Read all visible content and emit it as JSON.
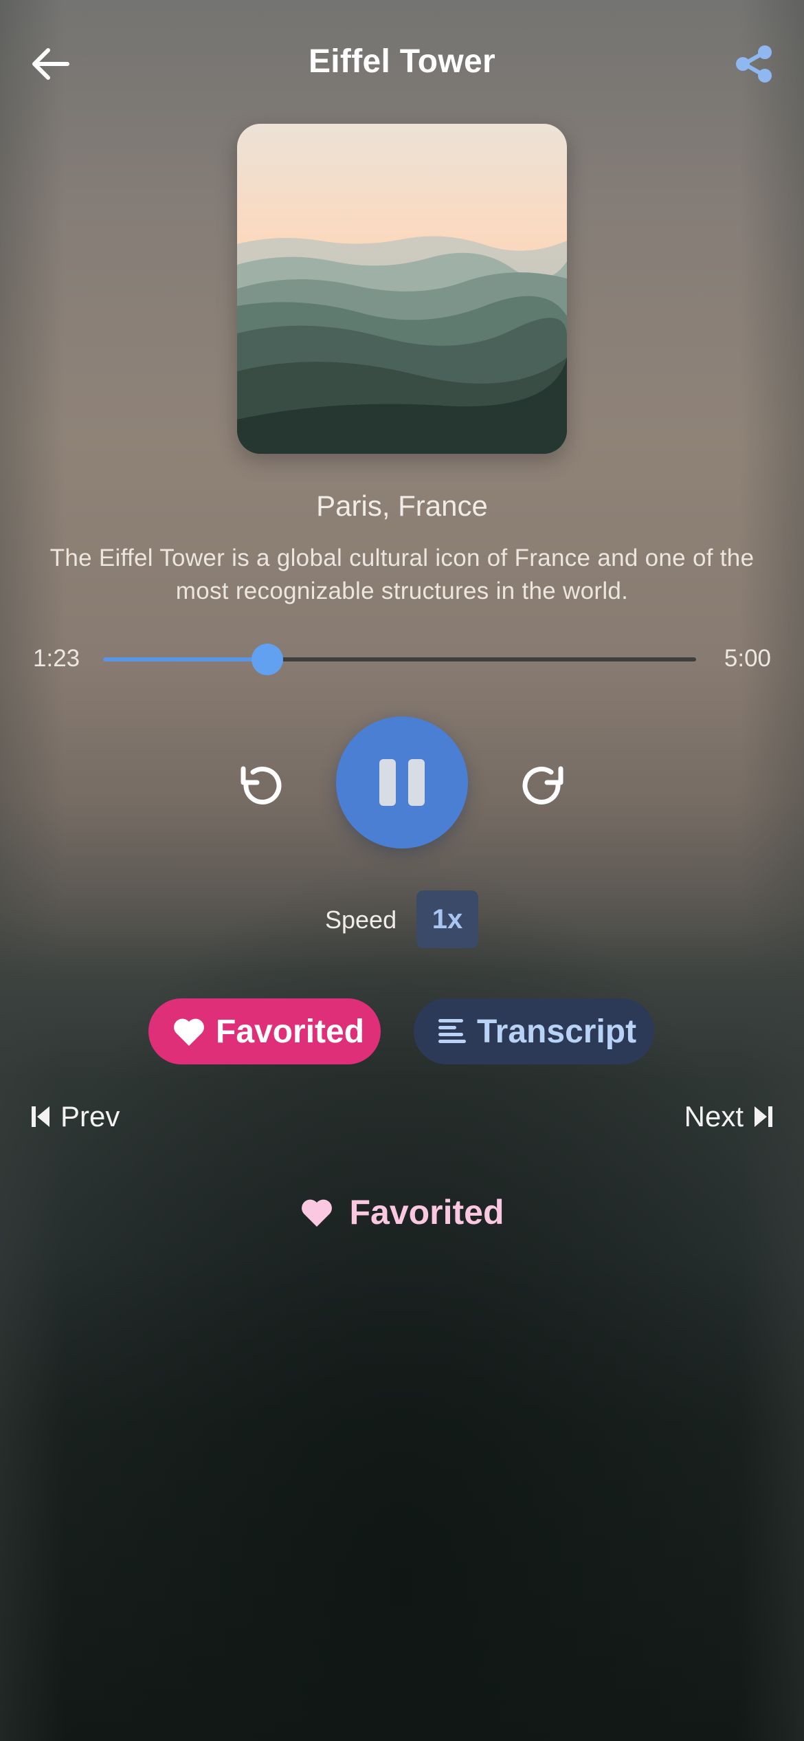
{
  "header": {
    "title": "Eiffel Tower",
    "back_icon": "arrow-left-icon",
    "share_icon": "share-icon",
    "share_color": "#8fb8f0"
  },
  "artwork": {
    "alt": "Misty mountain ridges at sunset"
  },
  "track": {
    "location": "Paris, France",
    "description": "The Eiffel Tower is a global cultural icon of France and one of the most recognizable structures in the world."
  },
  "player": {
    "current_time": "1:23",
    "total_time": "5:00",
    "progress": 0.277,
    "accent_color": "#5b95e6",
    "state": "playing",
    "rewind_icon": "rotate-ccw-icon",
    "forward_icon": "rotate-cw-icon",
    "pause_icon": "pause-icon"
  },
  "speed": {
    "label": "Speed",
    "value": "1x"
  },
  "actions": {
    "favorite_label": "Favorited",
    "favorite_color": "#de2f78",
    "transcript_label": "Transcript",
    "transcript_color": "#2c3a57"
  },
  "navigation": {
    "prev_label": "Prev",
    "next_label": "Next"
  },
  "status": {
    "favorited_label": "Favorited",
    "color": "#fbc8e1"
  }
}
